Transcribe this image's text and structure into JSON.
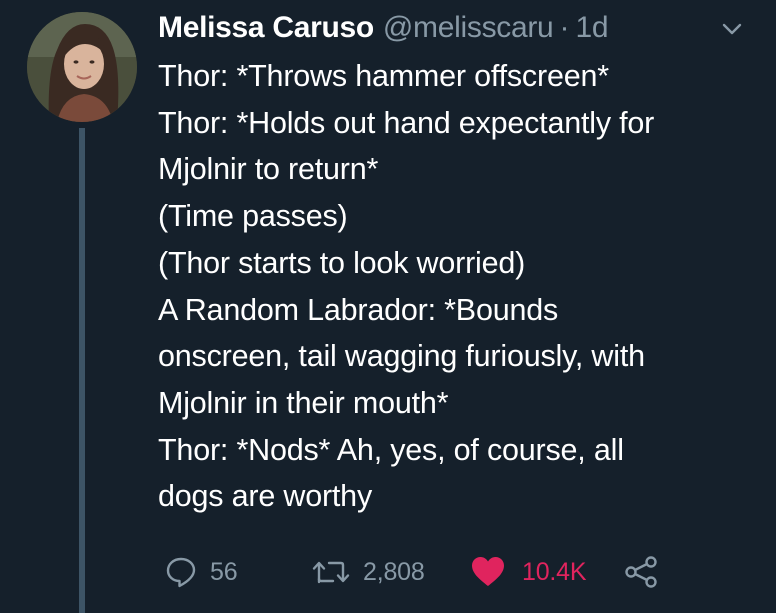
{
  "author": {
    "name": "Melissa Caruso",
    "handle": "@melisscaru",
    "separator": "·",
    "time": "1d"
  },
  "tweet": {
    "lines": [
      "Thor: *Throws hammer offscreen*",
      "Thor: *Holds out hand expectantly for",
      "Mjolnir to return*",
      "(Time passes)",
      "(Thor starts to look worried)",
      "A Random Labrador: *Bounds",
      "onscreen, tail wagging furiously, with",
      "Mjolnir in their mouth*",
      "Thor: *Nods* Ah, yes, of course, all",
      "dogs are worthy"
    ]
  },
  "actions": {
    "reply": {
      "icon": "reply-icon",
      "count": "56"
    },
    "retweet": {
      "icon": "retweet-icon",
      "count": "2,808"
    },
    "like": {
      "icon": "heart-icon",
      "count": "10.4K",
      "active": true
    },
    "share": {
      "icon": "share-icon"
    }
  },
  "colors": {
    "background": "#15202b",
    "text": "#ffffff",
    "muted": "#8899a6",
    "like": "#e0245e",
    "thread_line": "#3d5466"
  }
}
